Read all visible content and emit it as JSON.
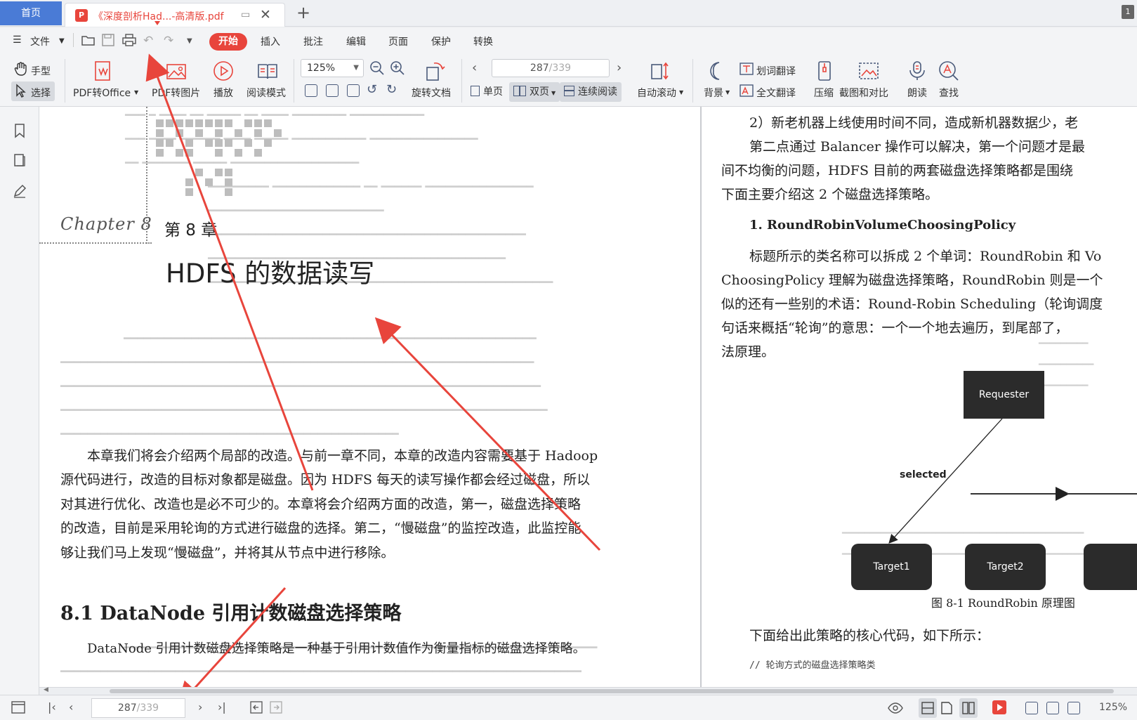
{
  "tabs": {
    "home_label": "首页",
    "doc_title": "《深度剖析Had...-高清版.pdf",
    "badge": "1"
  },
  "menu": {
    "file_label": "文件",
    "items": [
      "开始",
      "插入",
      "批注",
      "编辑",
      "页面",
      "保护",
      "转换"
    ]
  },
  "toolbar": {
    "hand": "手型",
    "select": "选择",
    "pdf_to_office": "PDF转Office",
    "pdf_to_image": "PDF转图片",
    "play": "播放",
    "read_mode": "阅读模式",
    "zoom": "125%",
    "rotate": "旋转文档",
    "page_current": "287",
    "page_total": "/339",
    "single": "单页",
    "double": "双页",
    "continuous": "连续阅读",
    "auto_scroll": "自动滚动",
    "background": "背景",
    "word_translate": "划词翻译",
    "full_translate": "全文翻译",
    "compress": "压缩",
    "screenshot_compare": "截图和对比",
    "read_aloud": "朗读",
    "find": "查找"
  },
  "left_page": {
    "chapter_script": "Chapter 8",
    "chapter_num": "第 8 章",
    "chapter_title": "HDFS 的数据读写",
    "para": [
      "本章我们将会介绍两个局部的改造。与前一章不同，本章的改造内容需要基于 Hadoop",
      "源代码进行，改造的目标对象都是磁盘。因为 HDFS 每天的读写操作都会经过磁盘，所以",
      "对其进行优化、改造也是必不可少的。本章将会介绍两方面的改造，第一，磁盘选择策略",
      "的改造，目前是采用轮询的方式进行磁盘的选择。第二，“慢磁盘”的监控改造，此监控能",
      "够让我们马上发现“慢磁盘”，并将其从节点中进行移除。"
    ],
    "section_title": "8.1   DataNode 引用计数磁盘选择策略",
    "section_first_line": "DataNode 引用计数磁盘选择策略是一种基于引用计数值作为衡量指标的磁盘选择策略。"
  },
  "right_page": {
    "lines": [
      "2）新老机器上线使用时间不同，造成新机器数据少，老",
      "第二点通过 Balancer 操作可以解决，第一个问题才是最",
      "间不均衡的问题，HDFS 目前的两套磁盘选择策略都是围绕",
      "下面主要介绍这 2 个磁盘选择策略。"
    ],
    "heading": "1. RoundRobinVolumeChoosingPolicy",
    "lines2": [
      "标题所示的类名称可以拆成 2 个单词：RoundRobin 和 Vo",
      "ChoosingPolicy 理解为磁盘选择策略，RoundRobin 则是一个",
      "似的还有一些别的术语：Round-Robin Scheduling（轮询调度",
      "句话来概括“轮询”的意思：一个一个地去遍历，到尾部了，",
      "法原理。"
    ],
    "diagram": {
      "requester": "Requester",
      "selected": "selected",
      "target1": "Target1",
      "target2": "Target2"
    },
    "figure_caption": "图 8-1   RoundRobin 原理图",
    "after_figure": "下面给出此策略的核心代码，如下所示：",
    "code_comment": "// 轮询方式的磁盘选择策略类"
  },
  "status": {
    "page_current": "287",
    "page_total": "/339",
    "zoom": "125%"
  },
  "colors": {
    "accent_red": "#e8453c",
    "home_tab_blue": "#4a7bd6",
    "annotation_arrow": "#e8453c"
  }
}
